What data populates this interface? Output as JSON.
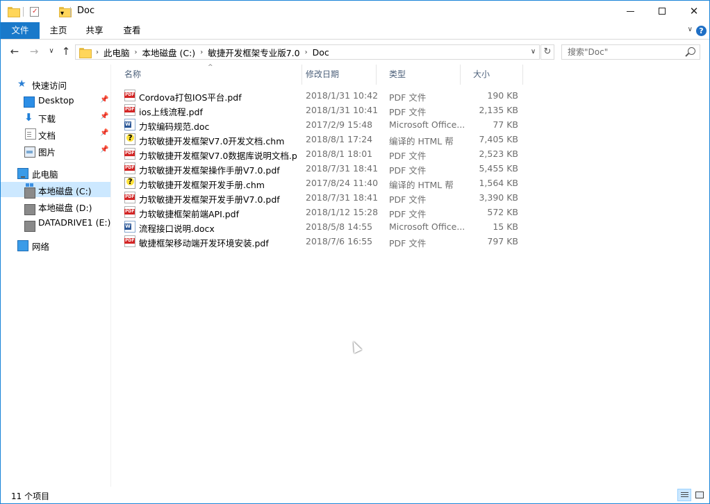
{
  "window": {
    "title": "Doc",
    "minimize_icon": "minimize-icon",
    "maximize_icon": "maximize-icon",
    "close_glyph": "✕"
  },
  "ribbon": {
    "tabs": [
      "文件",
      "主页",
      "共享",
      "查看"
    ],
    "help_glyph": "?",
    "expand_glyph": "∨"
  },
  "address": {
    "back_glyph": "←",
    "forward_glyph": "→",
    "recent_glyph": "∨",
    "up_glyph": "↑",
    "crumbs": [
      "此电脑",
      "本地磁盘 (C:)",
      "敏捷开发框架专业版7.0",
      "Doc"
    ],
    "crumb_sep": "›",
    "dropdown_glyph": "∨",
    "refresh_glyph": "↻",
    "search_placeholder": "搜索\"Doc\""
  },
  "nav": {
    "quick_access": "快速访问",
    "items": [
      {
        "label": "Desktop",
        "icon": "desktop-icon",
        "pinned": true
      },
      {
        "label": "下载",
        "icon": "download-icon",
        "pinned": true
      },
      {
        "label": "文档",
        "icon": "document-icon",
        "pinned": true
      },
      {
        "label": "图片",
        "icon": "pictures-icon",
        "pinned": true
      }
    ],
    "this_pc": "此电脑",
    "drives": [
      {
        "label": "本地磁盘 (C:)",
        "selected": true
      },
      {
        "label": "本地磁盘 (D:)",
        "selected": false
      },
      {
        "label": "DATADRIVE1 (E:)",
        "selected": false
      }
    ],
    "network": "网络",
    "pin_glyph": "📌",
    "star_glyph": "★",
    "down_glyph": "⬇"
  },
  "columns": {
    "name": "名称",
    "date": "修改日期",
    "type": "类型",
    "size": "大小",
    "sort_glyph": "^"
  },
  "files": [
    {
      "name": "Cordova打包IOS平台.pdf",
      "date": "2018/1/31 10:42",
      "type": "PDF 文件",
      "size": "190 KB",
      "kind": "pdf"
    },
    {
      "name": "ios上线流程.pdf",
      "date": "2018/1/31 10:41",
      "type": "PDF 文件",
      "size": "2,135 KB",
      "kind": "pdf"
    },
    {
      "name": "力软编码规范.doc",
      "date": "2017/2/9 15:48",
      "type": "Microsoft Office...",
      "size": "77 KB",
      "kind": "word"
    },
    {
      "name": "力软敏捷开发框架V7.0开发文档.chm",
      "date": "2018/8/1 17:24",
      "type": "编译的 HTML 帮",
      "size": "7,405 KB",
      "kind": "chm"
    },
    {
      "name": "力软敏捷开发框架V7.0数据库说明文档.p",
      "date": "2018/8/1 18:01",
      "type": "PDF 文件",
      "size": "2,523 KB",
      "kind": "pdf"
    },
    {
      "name": "力软敏捷开发框架操作手册V7.0.pdf",
      "date": "2018/7/31 18:41",
      "type": "PDF 文件",
      "size": "5,455 KB",
      "kind": "pdf"
    },
    {
      "name": "力软敏捷开发框架开发手册.chm",
      "date": "2017/8/24 11:40",
      "type": "编译的 HTML 帮",
      "size": "1,564 KB",
      "kind": "chm"
    },
    {
      "name": "力软敏捷开发框架开发手册V7.0.pdf",
      "date": "2018/7/31 18:41",
      "type": "PDF 文件",
      "size": "3,390 KB",
      "kind": "pdf"
    },
    {
      "name": "力软敏捷框架前端API.pdf",
      "date": "2018/1/12 15:28",
      "type": "PDF 文件",
      "size": "572 KB",
      "kind": "pdf"
    },
    {
      "name": "流程接口说明.docx",
      "date": "2018/5/8 14:55",
      "type": "Microsoft Office...",
      "size": "15 KB",
      "kind": "word"
    },
    {
      "name": "敏捷框架移动端开发环境安装.pdf",
      "date": "2018/7/6 16:55",
      "type": "PDF 文件",
      "size": "797 KB",
      "kind": "pdf"
    }
  ],
  "status": {
    "count_text": "11 个项目"
  },
  "colors": {
    "accent": "#1979ca",
    "selection": "#cce8ff",
    "muted_text": "#6d6d6d",
    "header_text": "#4c607a"
  }
}
